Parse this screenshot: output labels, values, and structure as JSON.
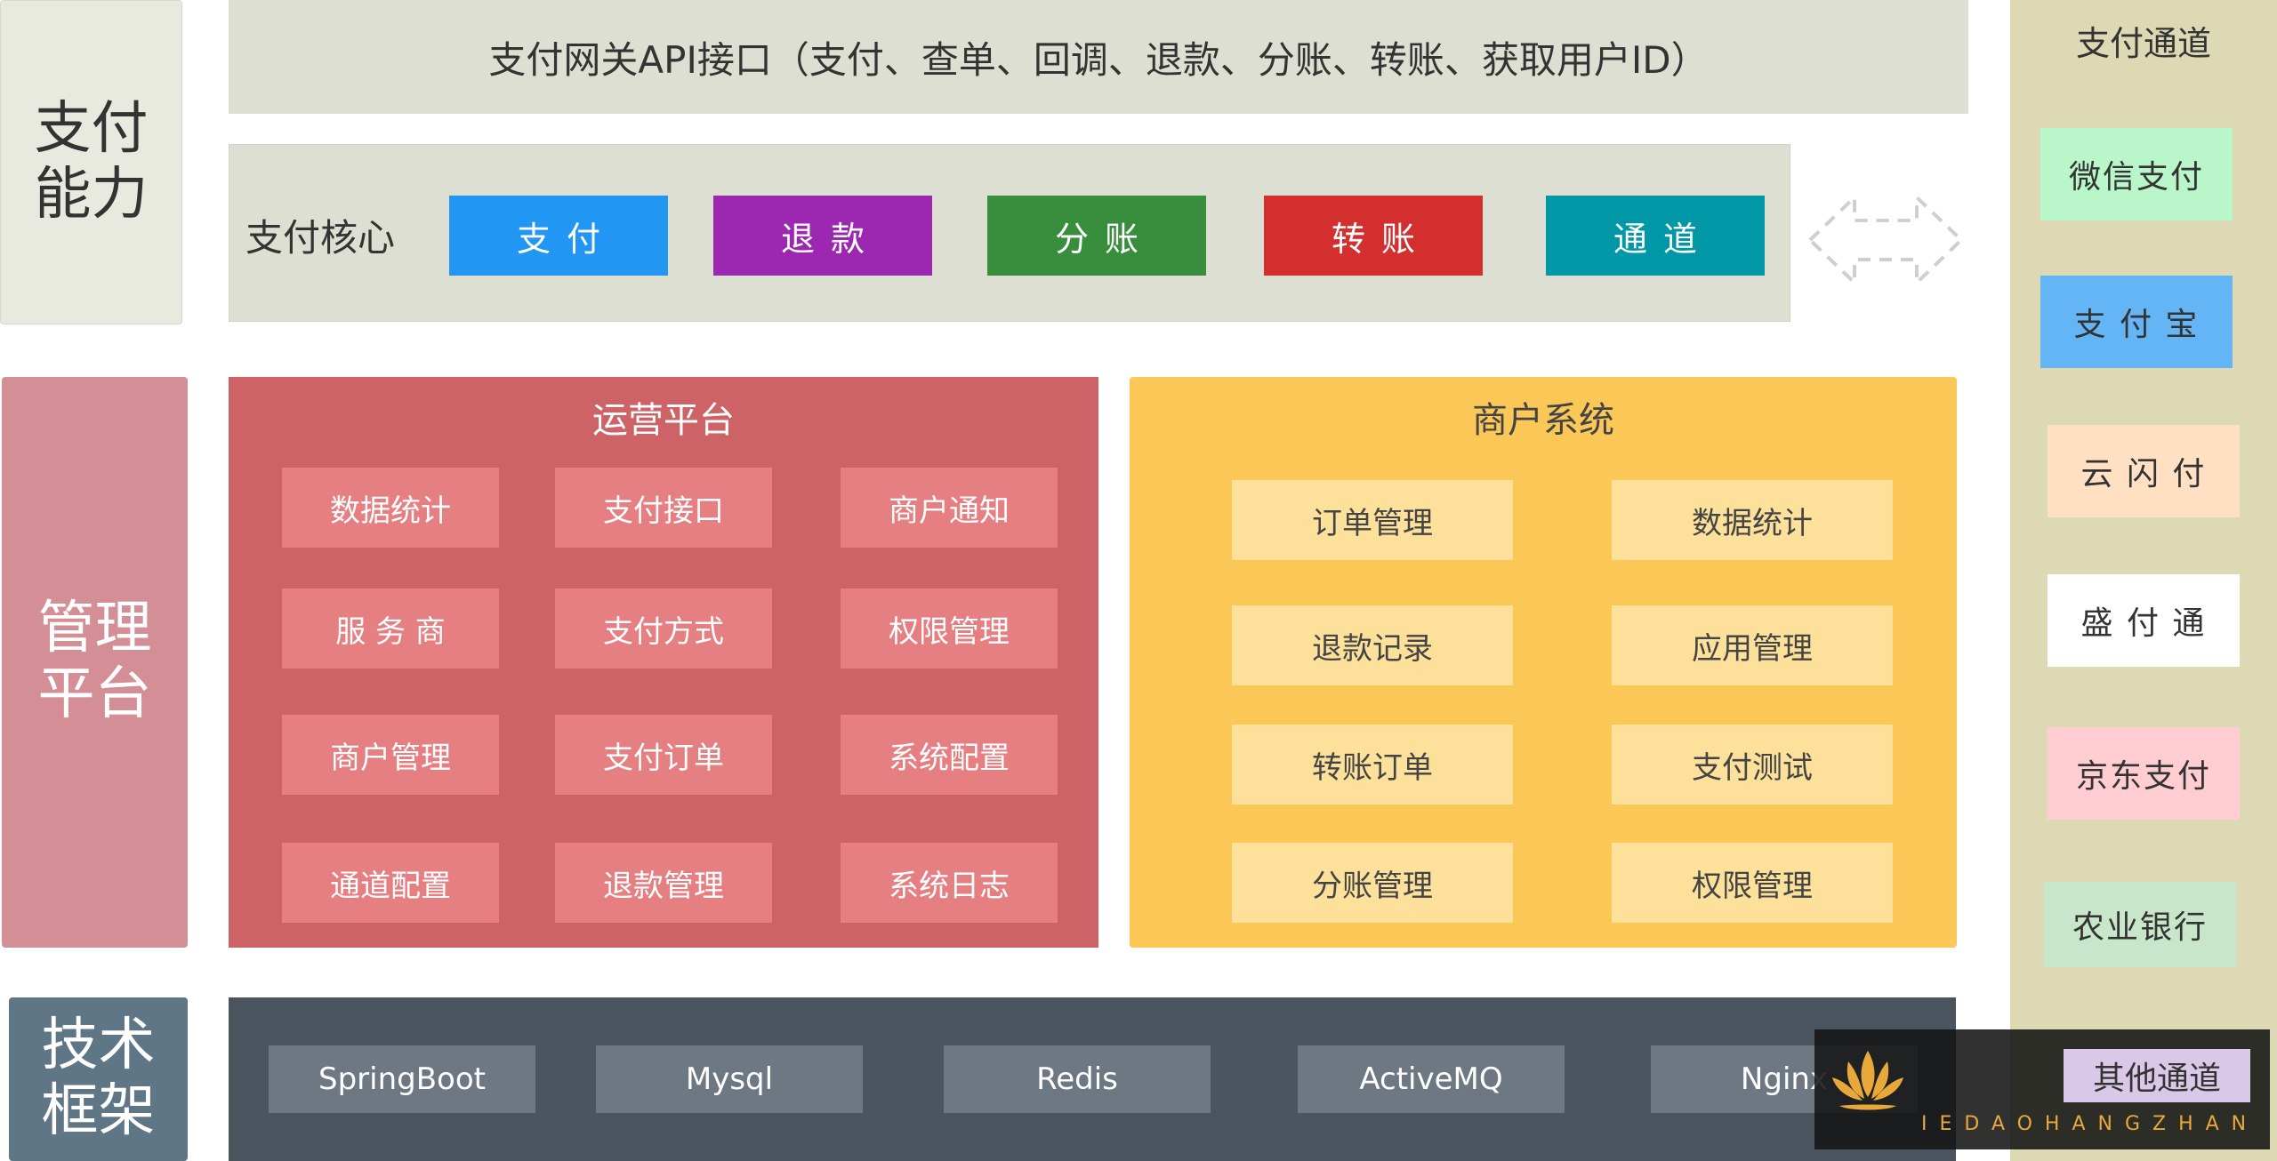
{
  "side_labels": {
    "pay": "支付\n能力",
    "mgmt": "管理\n平台",
    "tech": "技术\n框架"
  },
  "gateway": "支付网关API接口（支付、查单、回调、退款、分账、转账、获取用户ID）",
  "core": {
    "title": "支付核心",
    "buttons": [
      {
        "label": "支付",
        "color": "#2196f3"
      },
      {
        "label": "退款",
        "color": "#9c27b0"
      },
      {
        "label": "分账",
        "color": "#388e3c"
      },
      {
        "label": "转账",
        "color": "#d32f2f"
      },
      {
        "label": "通道",
        "color": "#0097a7"
      }
    ]
  },
  "ops": {
    "title": "运营平台",
    "items": [
      "数据统计",
      "支付接口",
      "商户通知",
      "服 务 商",
      "支付方式",
      "权限管理",
      "商户管理",
      "支付订单",
      "系统配置",
      "通道配置",
      "退款管理",
      "系统日志"
    ]
  },
  "merchant": {
    "title": "商户系统",
    "items": [
      "订单管理",
      "数据统计",
      "退款记录",
      "应用管理",
      "转账订单",
      "支付测试",
      "分账管理",
      "权限管理"
    ]
  },
  "tech": {
    "items": [
      "SpringBoot",
      "Mysql",
      "Redis",
      "ActiveMQ",
      "Nginx"
    ]
  },
  "channels": {
    "title": "支付通道",
    "items": [
      {
        "label": "微信支付",
        "color": "#b9f6ca"
      },
      {
        "label": "支 付 宝",
        "color": "#64b5f6"
      },
      {
        "label": "云 闪 付",
        "color": "#ffe0c2"
      },
      {
        "label": "盛 付 通",
        "color": "#ffffff"
      },
      {
        "label": "京东支付",
        "color": "#ffcdd2"
      },
      {
        "label": "农业银行",
        "color": "#c8e6c9"
      }
    ],
    "other": "其他通道"
  },
  "watermark": {
    "text": "IEDAOHANGZHAN"
  }
}
